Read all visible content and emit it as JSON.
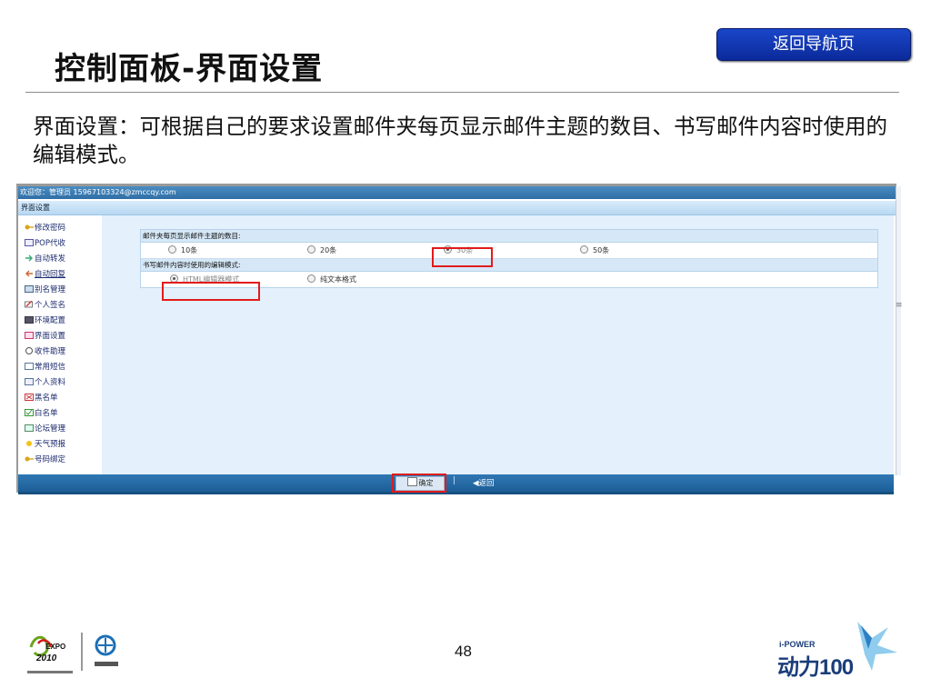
{
  "slide": {
    "title": "控制面板-界面设置",
    "nav_button": "返回导航页",
    "description": "界面设置：可根据自己的要求设置邮件夹每页显示邮件主题的数目、书写邮件内容时使用的编辑模式。",
    "page_number": "48"
  },
  "app": {
    "welcome": "欢迎您：管理员 15967103324@zmccqy.com",
    "section_title": "界面设置",
    "sidebar": [
      {
        "label": "修改密码",
        "icon": "key-icon"
      },
      {
        "label": "POP代收",
        "icon": "pop-icon"
      },
      {
        "label": "自动转发",
        "icon": "forward-icon"
      },
      {
        "label": "自动回复",
        "icon": "reply-icon"
      },
      {
        "label": "别名管理",
        "icon": "alias-icon"
      },
      {
        "label": "个人签名",
        "icon": "signature-icon"
      },
      {
        "label": "环境配置",
        "icon": "settings-icon"
      },
      {
        "label": "界面设置",
        "icon": "display-icon"
      },
      {
        "label": "收件助理",
        "icon": "inbox-icon"
      },
      {
        "label": "常用短信",
        "icon": "sms-icon"
      },
      {
        "label": "个人资料",
        "icon": "profile-icon"
      },
      {
        "label": "黑名单",
        "icon": "blacklist-icon"
      },
      {
        "label": "白名单",
        "icon": "whitelist-icon"
      },
      {
        "label": "论坛管理",
        "icon": "forum-icon"
      },
      {
        "label": "天气预报",
        "icon": "weather-icon"
      },
      {
        "label": "号码绑定",
        "icon": "phone-bind-icon"
      }
    ],
    "per_page": {
      "label": "邮件夹每页显示邮件主题的数目:",
      "options": [
        "10条",
        "20条",
        "30条",
        "50条"
      ],
      "selected": "30条"
    },
    "editor_mode": {
      "label": "书写邮件内容时使用的编辑模式:",
      "options": [
        "HTML编辑器模式",
        "纯文本格式"
      ],
      "selected": "HTML编辑器模式"
    },
    "confirm_button": "确定",
    "separator": "|",
    "back_link": "返回",
    "scroll_mark": "≡"
  },
  "logos": {
    "expo": "EXPO",
    "expo_year": "2010",
    "ipower": "i-POWER",
    "ipower_brand": "动力100"
  },
  "colors": {
    "nav_button": "#0b2a9a",
    "app_header": "#2f6fa6",
    "highlight": "#e21b1b"
  }
}
